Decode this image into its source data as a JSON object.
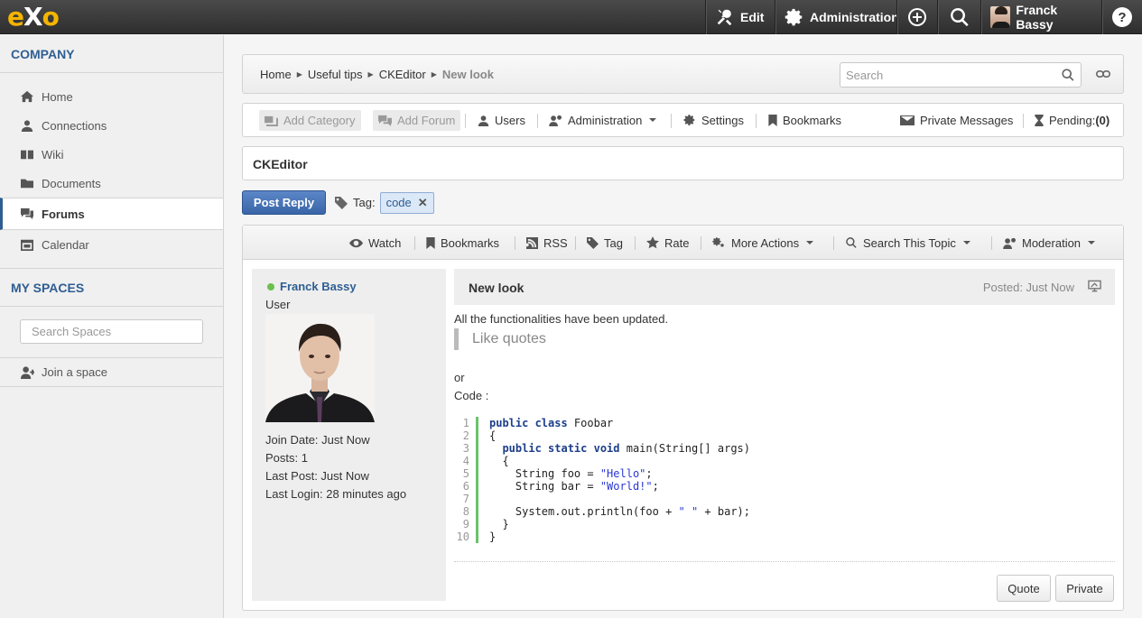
{
  "topbar": {
    "logo": "eXo",
    "edit_label": "Edit",
    "administration_label": "Administration",
    "user_name": "Franck Bassy"
  },
  "sidebar": {
    "company_title": "COMPANY",
    "items": [
      {
        "label": "Home",
        "icon": "home-icon"
      },
      {
        "label": "Connections",
        "icon": "person-icon"
      },
      {
        "label": "Wiki",
        "icon": "book-icon"
      },
      {
        "label": "Documents",
        "icon": "folder-icon"
      },
      {
        "label": "Forums",
        "icon": "chat-icon",
        "active": true
      },
      {
        "label": "Calendar",
        "icon": "calendar-icon"
      }
    ],
    "spaces_title": "MY SPACES",
    "search_spaces_placeholder": "Search Spaces",
    "join_space_label": "Join a space"
  },
  "breadcrumb": {
    "items": [
      "Home",
      "Useful tips",
      "CKEditor"
    ],
    "current": "New look",
    "search_placeholder": "Search"
  },
  "toolbar": {
    "add_category": "Add Category",
    "add_forum": "Add Forum",
    "users": "Users",
    "administration": "Administration",
    "settings": "Settings",
    "bookmarks": "Bookmarks",
    "private_messages": "Private Messages",
    "pending_label": "Pending:",
    "pending_count": "(0)"
  },
  "forum_title": "CKEditor",
  "actions": {
    "post_reply": "Post Reply",
    "tag_label": "Tag:",
    "tags": [
      "code"
    ]
  },
  "topic_toolbar": {
    "watch": "Watch",
    "bookmarks": "Bookmarks",
    "rss": "RSS",
    "tag": "Tag",
    "rate": "Rate",
    "more_actions": "More Actions",
    "search_topic": "Search This Topic",
    "moderation": "Moderation"
  },
  "author": {
    "name": "Franck Bassy",
    "role": "User",
    "join_date": "Join Date: Just Now",
    "posts": "Posts: 1",
    "last_post": "Last Post: Just Now",
    "last_login": "Last Login: 28 minutes ago"
  },
  "post": {
    "title": "New look",
    "posted": "Posted: Just Now",
    "intro": "All the functionalities have been updated.",
    "quote": "Like quotes",
    "or_text": "or",
    "code_label": "Code :",
    "code_lines": [
      {
        "n": "1",
        "text": "public class Foobar"
      },
      {
        "n": "2",
        "text": "{"
      },
      {
        "n": "3",
        "text": "  public static void main(String[] args)"
      },
      {
        "n": "4",
        "text": "  {"
      },
      {
        "n": "5",
        "text": "    String foo = \"Hello\";"
      },
      {
        "n": "6",
        "text": "    String bar = \"World!\";"
      },
      {
        "n": "7",
        "text": ""
      },
      {
        "n": "8",
        "text": "    System.out.println(foo + \" \" + bar);"
      },
      {
        "n": "9",
        "text": "  }"
      },
      {
        "n": "10",
        "text": "}"
      }
    ],
    "quote_button": "Quote",
    "private_button": "Private"
  },
  "colors": {
    "brand_blue": "#2f5e92",
    "primary_button": "#3a66a8",
    "logo_yellow": "#f4b400",
    "online_green": "#6cbf4d"
  }
}
